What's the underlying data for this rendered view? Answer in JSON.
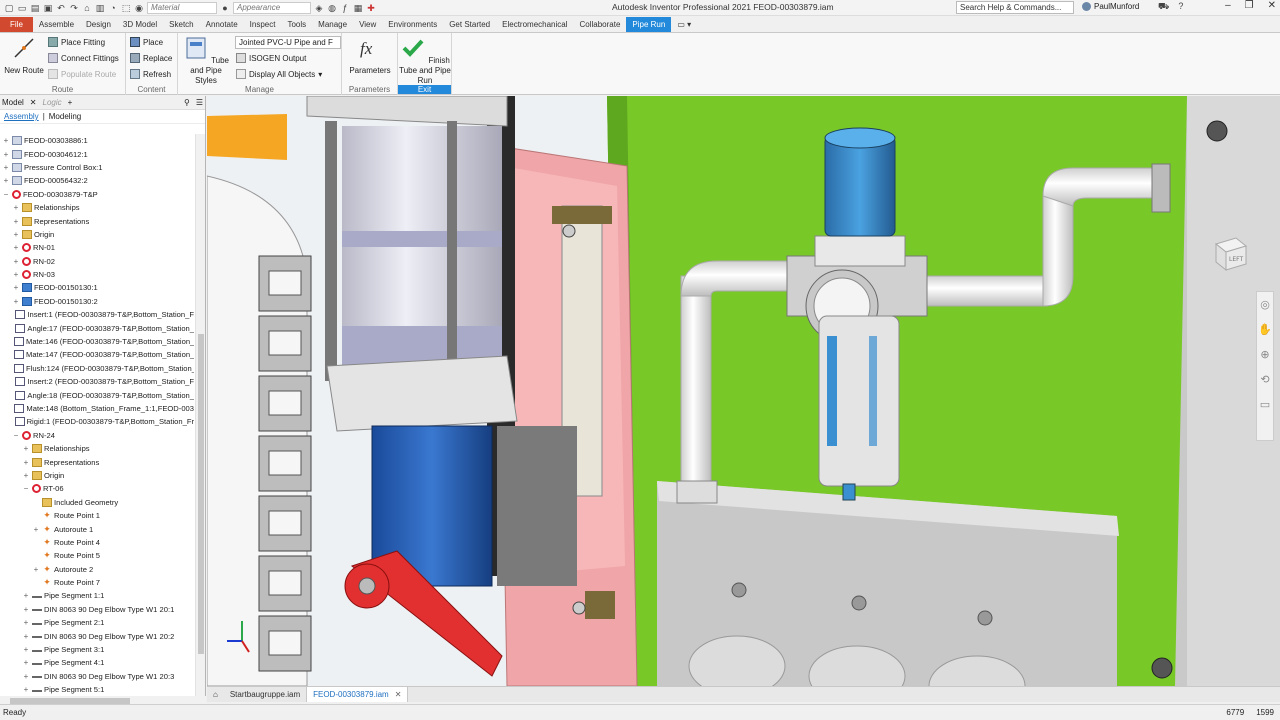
{
  "window": {
    "title": "Autodesk Inventor Professional 2021   FEOD-00303879.iam",
    "search_placeholder": "Search Help & Commands...",
    "user": "PaulMunford",
    "material_selector": "Material",
    "appearance_selector": "Appearance"
  },
  "ribbon_tabs": [
    "File",
    "Assemble",
    "Design",
    "3D Model",
    "Sketch",
    "Annotate",
    "Inspect",
    "Tools",
    "Manage",
    "View",
    "Environments",
    "Get Started",
    "Electromechanical",
    "Collaborate",
    "Pipe Run"
  ],
  "active_tab": "Pipe Run",
  "ribbon": {
    "route": {
      "label": "Route",
      "new_route": "New Route",
      "place_fitting": "Place Fitting",
      "connect_fittings": "Connect Fittings",
      "populate_route": "Populate Route"
    },
    "content": {
      "label": "Content",
      "place": "Place",
      "replace": "Replace",
      "refresh": "Refresh"
    },
    "manage": {
      "label": "Manage",
      "styles": "Tube and Pipe Styles",
      "style_select": "Jointed PVC-U Pipe and F",
      "isogen": "ISOGEN Output",
      "display_all": "Display All Objects"
    },
    "parameters": {
      "label": "Parameters",
      "button": "Parameters"
    },
    "exit": {
      "label": "Exit",
      "button": "Finish Tube and Pipe Run"
    }
  },
  "browser": {
    "tabs": [
      "Model",
      "Logic"
    ],
    "subtabs": [
      "Assembly",
      "Modeling"
    ],
    "tree": [
      {
        "level": 0,
        "exp": "+",
        "icon": "asm",
        "label": "FEOD-00303886:1"
      },
      {
        "level": 0,
        "exp": "+",
        "icon": "asm",
        "label": "FEOD-00304612:1"
      },
      {
        "level": 0,
        "exp": "+",
        "icon": "asm",
        "label": "Pressure Control Box:1"
      },
      {
        "level": 0,
        "exp": "+",
        "icon": "asm",
        "label": "FEOD-00056432:2"
      },
      {
        "level": 0,
        "exp": "−",
        "icon": "run",
        "label": "FEOD-00303879-T&P"
      },
      {
        "level": 1,
        "exp": "+",
        "icon": "folder",
        "label": "Relationships"
      },
      {
        "level": 1,
        "exp": "+",
        "icon": "folder",
        "label": "Representations"
      },
      {
        "level": 1,
        "exp": "+",
        "icon": "folder",
        "label": "Origin"
      },
      {
        "level": 1,
        "exp": "+",
        "icon": "run",
        "label": "RN-01"
      },
      {
        "level": 1,
        "exp": "+",
        "icon": "run",
        "label": "RN-02"
      },
      {
        "level": 1,
        "exp": "+",
        "icon": "run",
        "label": "RN-03"
      },
      {
        "level": 1,
        "exp": "+",
        "icon": "part",
        "label": "FEOD-00150130:1"
      },
      {
        "level": 1,
        "exp": "+",
        "icon": "part",
        "label": "FEOD-00150130:2"
      },
      {
        "level": 1,
        "exp": "",
        "icon": "cons",
        "label": "Insert:1 (FEOD-00303879-T&P,Bottom_Station_F"
      },
      {
        "level": 1,
        "exp": "",
        "icon": "cons",
        "label": "Angle:17 (FEOD-00303879-T&P,Bottom_Station_"
      },
      {
        "level": 1,
        "exp": "",
        "icon": "cons",
        "label": "Mate:146 (FEOD-00303879-T&P,Bottom_Station_"
      },
      {
        "level": 1,
        "exp": "",
        "icon": "cons",
        "label": "Mate:147 (FEOD-00303879-T&P,Bottom_Station_"
      },
      {
        "level": 1,
        "exp": "",
        "icon": "cons",
        "label": "Flush:124 (FEOD-00303879-T&P,Bottom_Station_"
      },
      {
        "level": 1,
        "exp": "",
        "icon": "cons",
        "label": "Insert:2 (FEOD-00303879-T&P,Bottom_Station_F"
      },
      {
        "level": 1,
        "exp": "",
        "icon": "cons",
        "label": "Angle:18 (FEOD-00303879-T&P,Bottom_Station_"
      },
      {
        "level": 1,
        "exp": "",
        "icon": "cons",
        "label": "Mate:148 (Bottom_Station_Frame_1:1,FEOD-003"
      },
      {
        "level": 1,
        "exp": "",
        "icon": "cons",
        "label": "Rigid:1 (FEOD-00303879-T&P,Bottom_Station_Fr"
      },
      {
        "level": 1,
        "exp": "−",
        "icon": "run",
        "label": "RN-24"
      },
      {
        "level": 2,
        "exp": "+",
        "icon": "folder",
        "label": "Relationships"
      },
      {
        "level": 2,
        "exp": "+",
        "icon": "folder",
        "label": "Representations"
      },
      {
        "level": 2,
        "exp": "+",
        "icon": "folder",
        "label": "Origin"
      },
      {
        "level": 2,
        "exp": "−",
        "icon": "run",
        "label": "RT-06"
      },
      {
        "level": 3,
        "exp": "",
        "icon": "folder",
        "label": "Included Geometry"
      },
      {
        "level": 3,
        "exp": "",
        "icon": "pt",
        "label": "Route Point 1"
      },
      {
        "level": 3,
        "exp": "+",
        "icon": "pt",
        "label": "Autoroute 1"
      },
      {
        "level": 3,
        "exp": "",
        "icon": "pt",
        "label": "Route Point 4"
      },
      {
        "level": 3,
        "exp": "",
        "icon": "pt",
        "label": "Route Point 5"
      },
      {
        "level": 3,
        "exp": "+",
        "icon": "pt",
        "label": "Autoroute 2"
      },
      {
        "level": 3,
        "exp": "",
        "icon": "pt",
        "label": "Route Point 7"
      },
      {
        "level": 2,
        "exp": "+",
        "icon": "seg",
        "label": "Pipe Segment 1:1"
      },
      {
        "level": 2,
        "exp": "+",
        "icon": "seg",
        "label": "DIN 8063 90 Deg Elbow Type W1 20:1"
      },
      {
        "level": 2,
        "exp": "+",
        "icon": "seg",
        "label": "Pipe Segment 2:1"
      },
      {
        "level": 2,
        "exp": "+",
        "icon": "seg",
        "label": "DIN 8063 90 Deg Elbow Type W1 20:2"
      },
      {
        "level": 2,
        "exp": "+",
        "icon": "seg",
        "label": "Pipe Segment 3:1"
      },
      {
        "level": 2,
        "exp": "+",
        "icon": "seg",
        "label": "Pipe Segment 4:1"
      },
      {
        "level": 2,
        "exp": "+",
        "icon": "seg",
        "label": "DIN 8063 90 Deg Elbow Type W1 20:3"
      },
      {
        "level": 2,
        "exp": "+",
        "icon": "seg",
        "label": "Pipe Segment 5:1"
      }
    ]
  },
  "viewcube": {
    "face": "LEFT"
  },
  "doc_tabs": [
    "Startbaugruppe.iam",
    "FEOD-00303879.iam"
  ],
  "active_doc": "FEOD-00303879.iam",
  "status": {
    "text": "Ready",
    "count1": "6779",
    "count2": "1599"
  },
  "colors": {
    "accent": "#2389da",
    "file_tab": "#d14a30",
    "panel_green": "#78c828",
    "filter_blue": "#3a8fd0"
  }
}
